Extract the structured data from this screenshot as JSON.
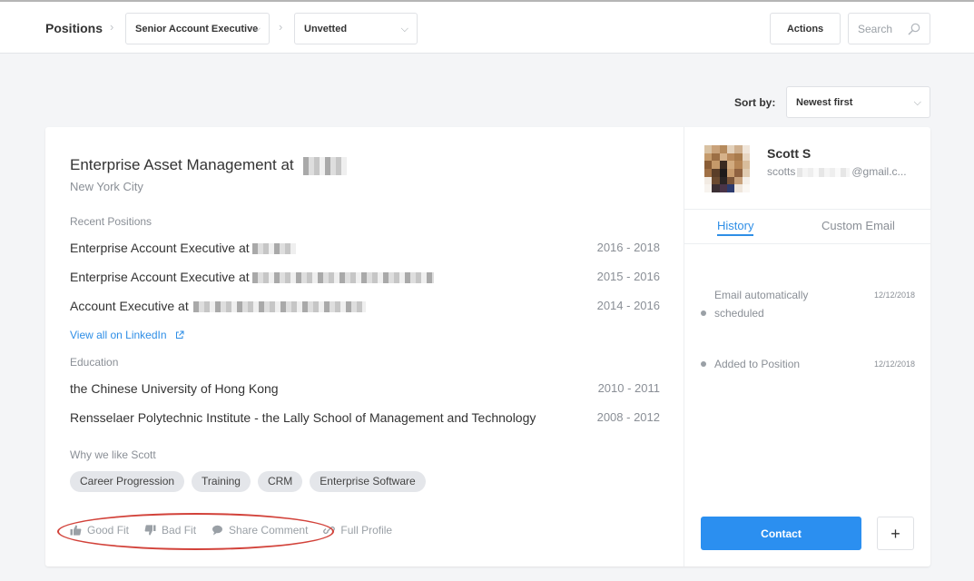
{
  "breadcrumb": {
    "title": "Positions",
    "position_select": "Senior Account Executive",
    "stage_select": "Unvetted"
  },
  "toolbar": {
    "actions_label": "Actions",
    "search_placeholder": "Search"
  },
  "sort": {
    "label": "Sort by:",
    "value": "Newest first"
  },
  "candidate": {
    "headline": "Enterprise Asset Management at",
    "location": "New York City",
    "recent_label": "Recent Positions",
    "positions": [
      {
        "title": "Enterprise Account Executive at",
        "years": "2016 - 2018"
      },
      {
        "title": "Enterprise Account Executive at",
        "years": "2015 - 2016"
      },
      {
        "title": "Account Executive at",
        "years": "2014 - 2016"
      }
    ],
    "linkedin_label": "View all on LinkedIn",
    "education_label": "Education",
    "education": [
      {
        "school": "the Chinese University of Hong Kong",
        "years": "2010 - 2011"
      },
      {
        "school": "Rensselaer Polytechnic Institute - the Lally School of Management and Technology",
        "years": "2008 - 2012"
      }
    ],
    "why_label": "Why we like Scott",
    "tags": [
      "Career Progression",
      "Training",
      "CRM",
      "Enterprise Software"
    ],
    "actions": {
      "good_fit": "Good Fit",
      "bad_fit": "Bad Fit",
      "share_comment": "Share Comment",
      "full_profile": "Full Profile"
    }
  },
  "profile": {
    "name": "Scott S",
    "email_prefix": "scotts",
    "email_suffix": "@gmail.c...",
    "tabs": [
      "History",
      "Custom Email"
    ],
    "history": [
      {
        "text": "Email automatically scheduled",
        "date": "12/12/2018"
      },
      {
        "text": "Added to Position",
        "date": "12/12/2018"
      }
    ],
    "contact_label": "Contact",
    "plus_label": "+"
  },
  "colors": {
    "accent": "#2e8ee6",
    "contact_button": "#2b8ff0",
    "annotation_oval": "#d2423a"
  }
}
